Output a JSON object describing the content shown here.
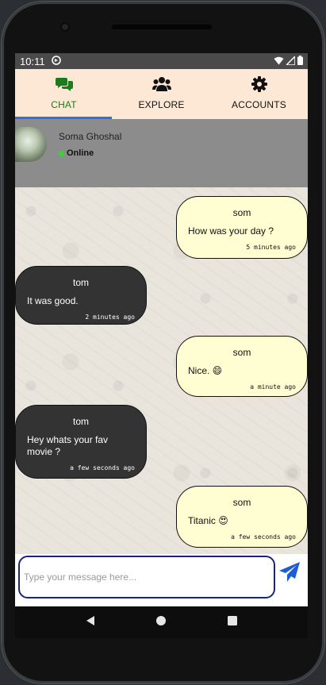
{
  "status_bar": {
    "time": "10:11",
    "sync_icon": "sync-icon",
    "wifi_icon": "wifi-icon",
    "signal_icon": "signal-icon",
    "battery_icon": "battery-icon"
  },
  "tabs": [
    {
      "label": "CHAT",
      "icon": "chat-bubbles-icon",
      "active": true
    },
    {
      "label": "EXPLORE",
      "icon": "users-icon",
      "active": false
    },
    {
      "label": "ACCOUNTS",
      "icon": "gear-icon",
      "active": false
    }
  ],
  "contact": {
    "name": "Soma Ghoshal",
    "status": "Online",
    "status_color": "#3ccf3c"
  },
  "messages": [
    {
      "sender": "som",
      "text": "How was your day ?",
      "time": "5 minutes ago",
      "mine": true
    },
    {
      "sender": "tom",
      "text": "It was good.",
      "time": "2 minutes ago",
      "mine": false
    },
    {
      "sender": "som",
      "text": "Nice. 😄",
      "time": "a minute ago",
      "mine": true
    },
    {
      "sender": "tom",
      "text": "Hey whats your fav movie ?",
      "time": "a few seconds ago",
      "mine": false
    },
    {
      "sender": "som",
      "text": "Titanic 😍",
      "time": "a few seconds ago",
      "mine": true
    }
  ],
  "input": {
    "placeholder": "Type your message here...",
    "value": ""
  },
  "colors": {
    "tab_bar": "#fde8d5",
    "active_tab": "#1e7a1e",
    "indicator": "#2f6fe0",
    "header": "#8c8c8c",
    "my_bubble": "#fffed2",
    "their_bubble": "#333333",
    "send_button": "#1e5bd6"
  }
}
